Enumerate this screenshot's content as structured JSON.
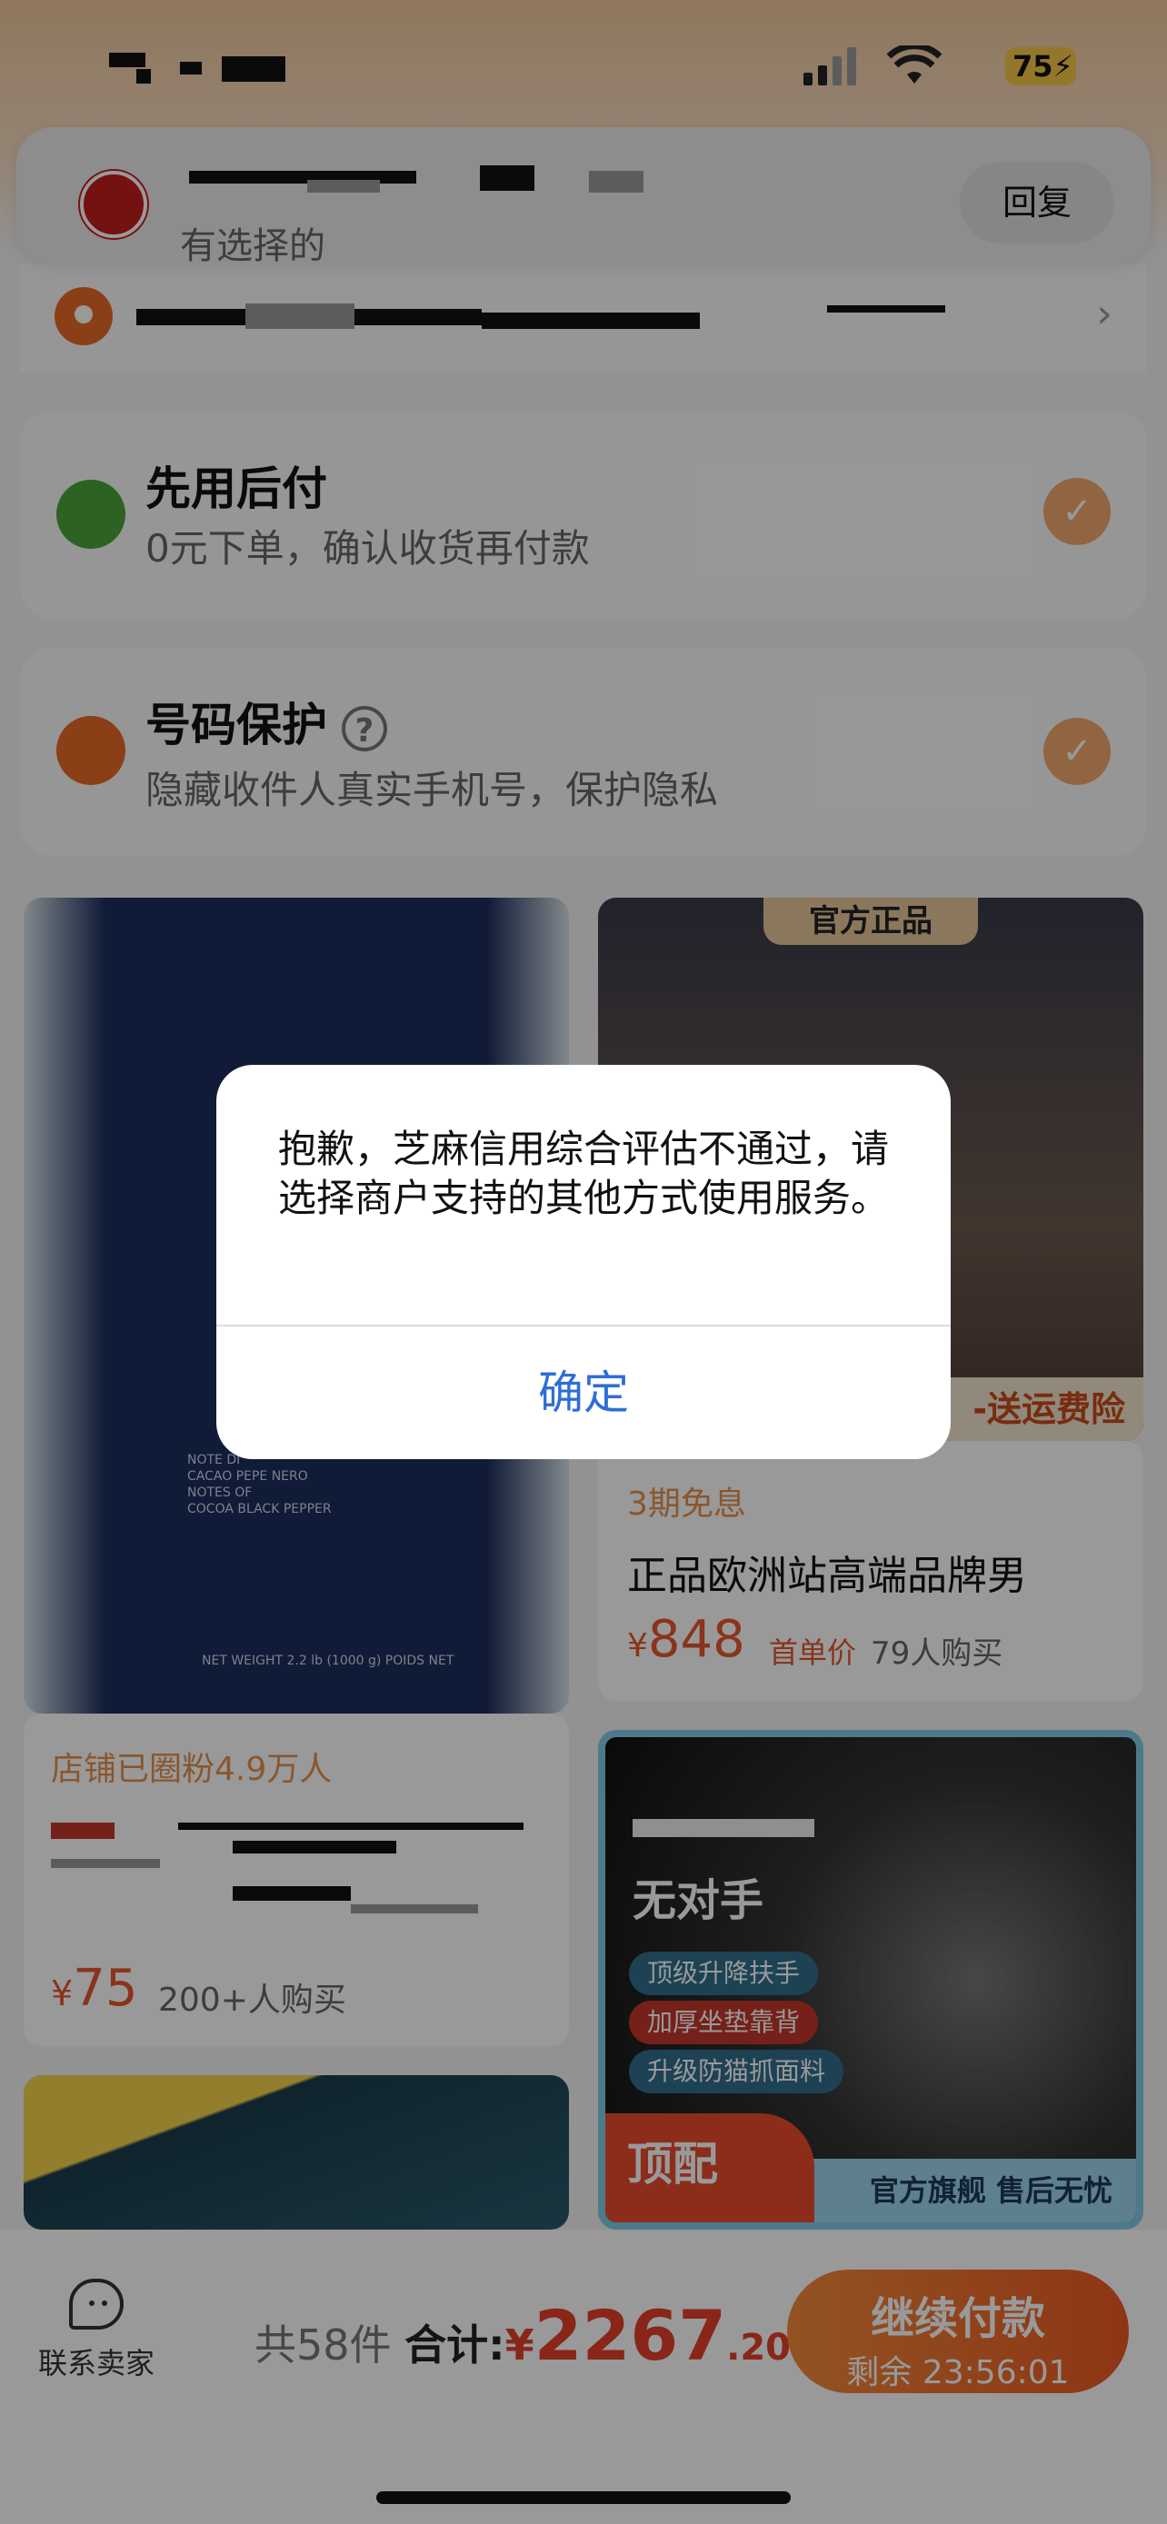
{
  "status_bar": {
    "battery": "75"
  },
  "banner": {
    "subtitle": "有选择的",
    "reply_label": "回复"
  },
  "cards": [
    {
      "title": "先用后付",
      "subtitle": "0元下单，确认收货再付款",
      "icon": "shopping-bag-check-icon",
      "icon_color": "#4aa43a"
    },
    {
      "title": "号码保护",
      "subtitle": "隐藏收件人真实手机号，保护隐私",
      "icon": "phone-shield-icon",
      "icon_color": "#e86a26"
    }
  ],
  "products": {
    "shoe": {
      "top_tag": "官方正品",
      "bottom_banner": "-送运费险",
      "promo": "3期免息",
      "title": "正品欧洲站高端品牌男",
      "currency": "¥",
      "price": "848",
      "price_label": "首单价",
      "sold": "79人购买"
    },
    "coffee": {
      "fans": "店铺已圈粉4.9万人",
      "currency": "¥",
      "price": "75",
      "sold": "200+人购买",
      "bag_text_1": "NOTE DI",
      "bag_text_2": "CACAO PEPE NERO",
      "bag_text_3": "NOTES OF",
      "bag_text_4": "COCOA BLACK PEPPER",
      "bag_weight": "NET WEIGHT 2.2 lb (1000 g) POIDS NET"
    },
    "chair": {
      "headline": "无对手",
      "features": [
        "顶级升降扶手",
        "加厚坐垫靠背",
        "升级防猫抓面料"
      ],
      "corner": "顶配",
      "footer": "官方旗舰  售后无忧"
    }
  },
  "bottom_bar": {
    "contact_label": "联系卖家",
    "count_text": "共58件",
    "total_label": "合计:",
    "currency": "¥",
    "total_int": "2267",
    "total_dec": ".20",
    "pay_label": "继续付款",
    "countdown": "剩余 23:56:01"
  },
  "dialog": {
    "message": "抱歉，芝麻信用综合评估不通过，请选择商户支持的其他方式使用服务。",
    "confirm_label": "确定"
  },
  "colors": {
    "accent": "#e4402a",
    "link_blue": "#2f6ed6",
    "check_orange": "#f2a96d"
  }
}
